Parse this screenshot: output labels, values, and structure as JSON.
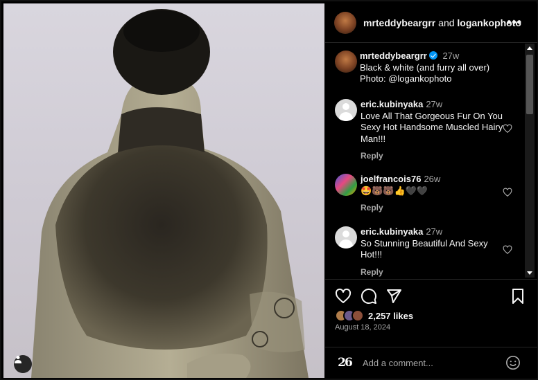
{
  "post": {
    "photo_alt": "",
    "author": "mrteddybeargrr",
    "collab_joiner": "and",
    "collaborator": "logankophoto",
    "caption_line1": "Black & white (and furry all over)",
    "caption_line2": "Photo: @logankophoto",
    "caption_time": "27w"
  },
  "comments": [
    {
      "user": "eric.kubinyaka",
      "time": "27w",
      "text": "Love All That Gorgeous Fur On You Sexy Hot Handsome Muscled Hairy Man!!!",
      "reply": "Reply"
    },
    {
      "user": "joelfrancois76",
      "time": "26w",
      "text": "🤩🐻🐻👍🖤🖤",
      "reply": "Reply"
    },
    {
      "user": "eric.kubinyaka",
      "time": "27w",
      "text": "So Stunning Beautiful And Sexy Hot!!!",
      "reply": "Reply"
    }
  ],
  "engagement": {
    "likes": "2,257 likes",
    "date": "August 18, 2024"
  },
  "composer": {
    "logo_text": "26",
    "placeholder": "Add a comment..."
  },
  "icons": {
    "more": "more-horizontal-icon",
    "like": "heart-icon",
    "comment": "comment-icon",
    "share": "send-icon",
    "save": "bookmark-icon",
    "emoji": "emoji-icon",
    "tag": "user-tag-icon"
  },
  "colors": {
    "background": "#000000",
    "text": "#f5f5f5",
    "secondary_text": "#a8a8a8",
    "verified": "#0095f6",
    "divider": "#262626"
  }
}
